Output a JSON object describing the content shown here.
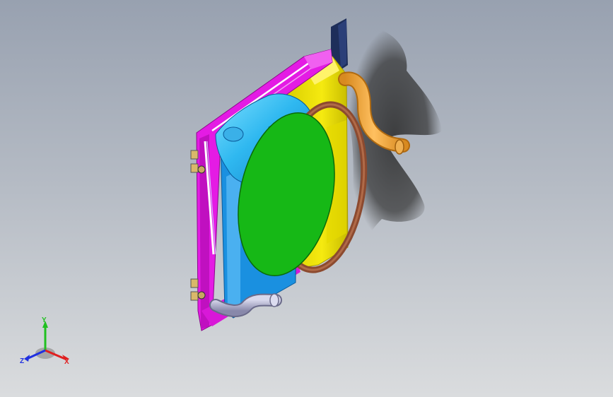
{
  "viewport": {
    "background_top": "#98a1b0",
    "background_bottom": "#dadcde"
  },
  "model": {
    "parts": [
      {
        "name": "radiator-frame",
        "color": "#e41be4"
      },
      {
        "name": "expansion-tank",
        "color": "#2fb8f0"
      },
      {
        "name": "fan-shroud",
        "color": "#f0e600"
      },
      {
        "name": "fan-disc",
        "color": "#16b816"
      },
      {
        "name": "fan-ring",
        "color": "#8c4a2f"
      },
      {
        "name": "upper-hose",
        "color": "#f0a030"
      },
      {
        "name": "lower-hose",
        "color": "#a8a8c8"
      },
      {
        "name": "rear-panel",
        "color": "#1e2e5a"
      }
    ]
  },
  "triad": {
    "x_label": "X",
    "y_label": "Y",
    "z_label": "Z",
    "x_color": "#e02020",
    "y_color": "#20c020",
    "z_color": "#2030e0"
  }
}
